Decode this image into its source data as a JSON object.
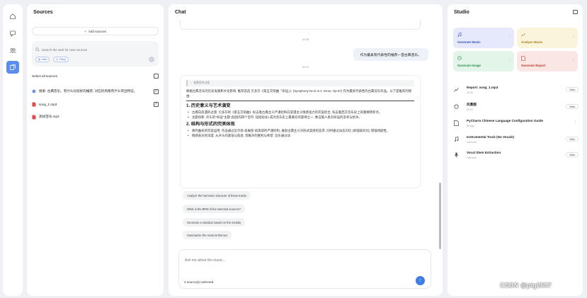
{
  "sources": {
    "title": "Sources",
    "add_label": "Add sources",
    "search_placeholder": "Search the web for new sources",
    "chips": [
      "Web",
      "Deep"
    ],
    "select_all": "Select all sources",
    "items": [
      {
        "name": "搜索: 古典音乐。有什么比较好的推荐, 对应的风格有什么突出特征。",
        "checked": true,
        "icon": "globe-icon"
      },
      {
        "name": "song_1.mp3",
        "checked": true,
        "icon": "file-audio-icon"
      },
      {
        "name": "测试音乐.mp3",
        "checked": false,
        "icon": "file-audio-icon"
      }
    ]
  },
  "chat": {
    "title": "Chat",
    "time1": "02:08",
    "user_message": "作为最具有代表性的推荐一首古典音乐。",
    "time2": "02:31",
    "answer": {
      "ref": "查看思考过程",
      "intro": "根据古典音乐的历史发展和文化影响, 推荐首选 贝多芬《第五交响曲「命运」》(Symphony No.5 in C minor, Op.67) 作为最具代表性的古典音乐作品。以下是推荐的理由:",
      "h1": "1. 历史意义与艺术演变",
      "b1": "古典向浪漫的过渡: 贝多芬的《第五交响曲》标志着古典主义严谨结构向浪漫主义情感张力的完美结合, 标志着西方音乐史上的重要转折点。",
      "b2": "主题创新: 开头的\"命运\"主题 (短短的四个音符: 短短短长) 成为音乐史上最著名的旋律之一, 象征着人类对命运的追寻与抗争。",
      "h2": "2. 结构与形式的完美体现",
      "b3": "奏鸣曲式的完美运用: 作品通过呈示部-发展部-再现部的严谨结构, 展现古典主义对形式美感的追求, 同时通过动态对比 (如强弱对比) 增强戏剧性。",
      "b4": "情感表达的深度: 从开头的紧张与焦虑, 到尾声的胜利与希望, 音乐通过动"
    },
    "suggestions": [
      "Analyze the harmonic structure of these tracks",
      "What is the BPM of the selected sources?",
      "Generate a variation based on the melody",
      "Summarize the musical themes"
    ],
    "input_placeholder": "Ask me about the music...",
    "selected_count": "2 source(s) selected"
  },
  "studio": {
    "title": "Studio",
    "tiles": [
      {
        "label": "Generate Music",
        "icon": "music-note-icon"
      },
      {
        "label": "Analyze Music",
        "icon": "chart-icon"
      },
      {
        "label": "Generate Image",
        "icon": "palette-icon"
      },
      {
        "label": "Generate Report",
        "icon": "document-icon"
      }
    ],
    "outputs": [
      {
        "title": "Report: song_1.mp3",
        "sub": "02:04",
        "action": "View"
      },
      {
        "title": "风景图",
        "sub": "22:10",
        "action": "View"
      },
      {
        "title": "PyCharm Chinese Language Configuration Guide",
        "sub": "5d ago",
        "action": "⋮"
      },
      {
        "title": "Instrumental Track (No Vocals)",
        "sub": "Just now",
        "action": "View"
      },
      {
        "title": "Vocal Stem Extraction",
        "sub": "Just now",
        "action": "View"
      }
    ]
  },
  "watermark": "CSDN @pig2687",
  "colors": {
    "accent": "#3d7be6",
    "rail_active": "#5b8def"
  }
}
